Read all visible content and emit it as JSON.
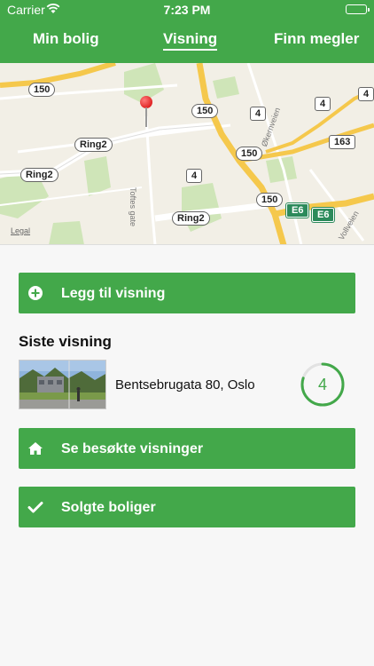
{
  "status_bar": {
    "carrier": "Carrier",
    "time": "7:23 PM"
  },
  "nav": {
    "tabs": [
      {
        "label": "Min bolig",
        "selected": false
      },
      {
        "label": "Visning",
        "selected": true
      },
      {
        "label": "Finn megler",
        "selected": false
      }
    ]
  },
  "map": {
    "road_labels": [
      "150",
      "150",
      "150",
      "150",
      "4",
      "4",
      "4",
      "4",
      "163",
      "Ring2",
      "Ring2",
      "Ring2",
      "E6",
      "E6"
    ],
    "streets": [
      "Toftes gate",
      "Økernveien",
      "Vollveien"
    ],
    "legal": "Legal"
  },
  "actions": {
    "add_viewing": "Legg til visning",
    "visited_viewings": "Se besøkte visninger",
    "sold_homes": "Solgte boliger"
  },
  "latest": {
    "title": "Siste visning",
    "address": "Bentsebrugata 80, Oslo",
    "score": "4",
    "score_fraction": 0.8
  },
  "colors": {
    "brand_green": "#43a84a",
    "map_bg": "#f2efe6",
    "road_yellow": "#f5c84c",
    "e6_green": "#2c8a5b"
  },
  "icons": {
    "add": "plus-circle-icon",
    "home": "home-icon",
    "check": "check-icon",
    "wifi": "wifi-icon",
    "battery": "battery-icon",
    "pin": "map-pin-icon"
  }
}
